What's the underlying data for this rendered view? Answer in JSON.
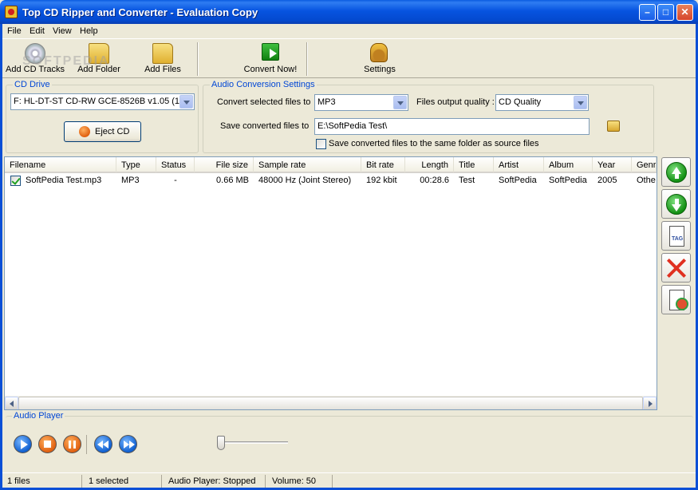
{
  "window": {
    "title": "Top CD Ripper and Converter - Evaluation Copy"
  },
  "menu": [
    "File",
    "Edit",
    "View",
    "Help"
  ],
  "toolbar": {
    "add_cd_tracks": "Add CD Tracks",
    "add_folder": "Add Folder",
    "add_files": "Add Files",
    "convert_now": "Convert Now!",
    "settings": "Settings"
  },
  "watermark": "SOFTPEDIA",
  "cd_drive": {
    "title": "CD Drive",
    "selected": "F: HL-DT-ST CD-RW GCE-8526B v1.05 (1:",
    "eject_label": "Eject CD"
  },
  "conversion": {
    "title": "Audio Conversion Settings",
    "convert_label": "Convert selected files to",
    "format": "MP3",
    "quality_label": "Files output quality :",
    "quality": "CD Quality",
    "save_label": "Save converted files to",
    "save_path": "E:\\SoftPedia Test\\",
    "same_folder_label": "Save converted files to the same folder as source files",
    "same_folder_checked": false
  },
  "table": {
    "columns": [
      "Filename",
      "Type",
      "Status",
      "File size",
      "Sample rate",
      "Bit rate",
      "Length",
      "Title",
      "Artist",
      "Album",
      "Year",
      "Genr"
    ],
    "rows": [
      {
        "checked": true,
        "filename": "SoftPedia Test.mp3",
        "type": "MP3",
        "status": "-",
        "size": "0.66 MB",
        "sample_rate": "48000 Hz (Joint Stereo)",
        "bit_rate": "192 kbit",
        "length": "00:28.6",
        "title": "Test",
        "artist": "SoftPedia",
        "album": "SoftPedia",
        "year": "2005",
        "genre": "Othe"
      }
    ]
  },
  "side_buttons": {
    "tag_text": "TAG"
  },
  "player": {
    "title": "Audio Player",
    "volume": 0
  },
  "status": {
    "files": "1 files",
    "selected": "1 selected",
    "player": "Audio Player: Stopped",
    "volume": "Volume: 50"
  },
  "colors": {
    "titlebar": "#0754e0",
    "accent": "#0046d5",
    "surface": "#ece9d8"
  }
}
